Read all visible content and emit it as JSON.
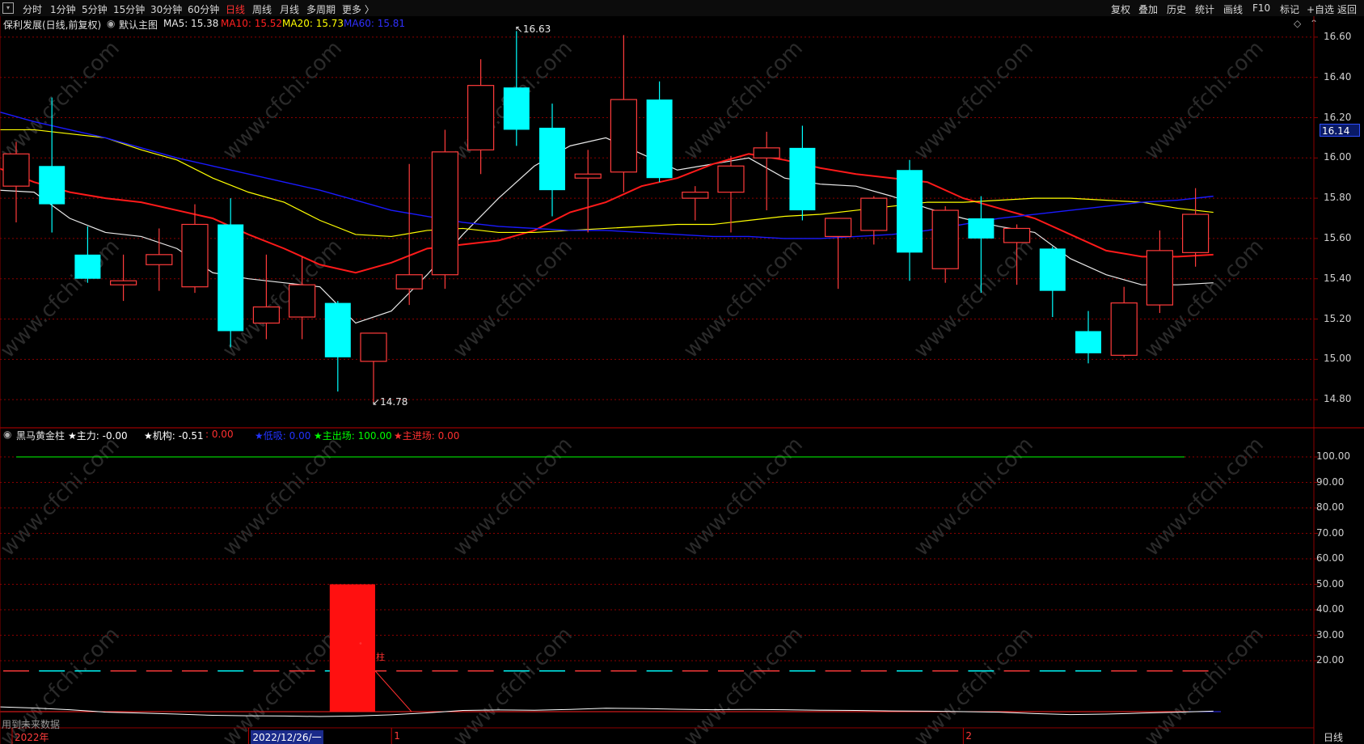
{
  "toolbar": {
    "left": [
      "分时",
      "1分钟",
      "5分钟",
      "15分钟",
      "30分钟",
      "60分钟",
      "日线",
      "周线",
      "月线",
      "多周期",
      "更多 〉"
    ],
    "right": [
      "复权",
      "叠加",
      "历史",
      "统计",
      "画线",
      "F10",
      "标记",
      "+自选",
      "返回"
    ],
    "active": "日线"
  },
  "header": {
    "stock": "保利发展(日线,前复权)",
    "main_chart": "默认主图",
    "ma5": "MA5: 15.38",
    "ma10": "MA10: 15.52",
    "ma20": "MA20: 15.73",
    "ma60": "MA60: 15.81"
  },
  "colors": {
    "up": "#ff3b3b",
    "down": "#00ffff",
    "ma5": "#e8e8e8",
    "ma10": "#ff1a1a",
    "ma20": "#ffff00",
    "ma60": "#1a1aff",
    "grid": "#8b0000",
    "green": "#00ff00"
  },
  "current_price": "16.14",
  "chart_data": [
    {
      "type": "candlestick",
      "title": "保利发展(日线,前复权)",
      "ylim": [
        14.68,
        16.7
      ],
      "ticks": [
        14.8,
        15.0,
        15.2,
        15.4,
        15.6,
        15.8,
        16.0,
        16.2,
        16.4,
        16.6
      ],
      "tick_labels": [
        "14.80",
        "15.00",
        "15.20",
        "15.40",
        "15.60",
        "15.80",
        "16.00",
        "16.20",
        "16.40",
        "16.60"
      ],
      "high_label": "16.63",
      "low_label": "14.78",
      "candles": [
        {
          "o": 15.86,
          "h": 16.08,
          "l": 15.68,
          "c": 16.02
        },
        {
          "o": 15.96,
          "h": 16.3,
          "l": 15.63,
          "c": 15.77
        },
        {
          "o": 15.52,
          "h": 15.66,
          "l": 15.38,
          "c": 15.4
        },
        {
          "o": 15.37,
          "h": 15.52,
          "l": 15.29,
          "c": 15.39
        },
        {
          "o": 15.47,
          "h": 15.65,
          "l": 15.34,
          "c": 15.52
        },
        {
          "o": 15.36,
          "h": 15.77,
          "l": 15.33,
          "c": 15.67
        },
        {
          "o": 15.67,
          "h": 15.8,
          "l": 15.06,
          "c": 15.14
        },
        {
          "o": 15.18,
          "h": 15.52,
          "l": 15.1,
          "c": 15.26
        },
        {
          "o": 15.21,
          "h": 15.51,
          "l": 15.1,
          "c": 15.37
        },
        {
          "o": 15.28,
          "h": 15.29,
          "l": 14.84,
          "c": 15.01
        },
        {
          "o": 14.99,
          "h": 15.13,
          "l": 14.78,
          "c": 15.13
        },
        {
          "o": 15.35,
          "h": 15.97,
          "l": 15.27,
          "c": 15.42
        },
        {
          "o": 15.42,
          "h": 16.14,
          "l": 15.35,
          "c": 16.03
        },
        {
          "o": 16.04,
          "h": 16.49,
          "l": 15.92,
          "c": 16.36
        },
        {
          "o": 16.35,
          "h": 16.63,
          "l": 16.06,
          "c": 16.14
        },
        {
          "o": 16.15,
          "h": 16.27,
          "l": 15.71,
          "c": 15.84
        },
        {
          "o": 15.9,
          "h": 16.04,
          "l": 15.63,
          "c": 15.92
        },
        {
          "o": 15.93,
          "h": 16.61,
          "l": 15.83,
          "c": 16.29
        },
        {
          "o": 16.29,
          "h": 16.38,
          "l": 15.88,
          "c": 15.9
        },
        {
          "o": 15.8,
          "h": 15.86,
          "l": 15.69,
          "c": 15.83
        },
        {
          "o": 15.83,
          "h": 16.01,
          "l": 15.63,
          "c": 15.96
        },
        {
          "o": 16.0,
          "h": 16.13,
          "l": 15.74,
          "c": 16.05
        },
        {
          "o": 16.05,
          "h": 16.16,
          "l": 15.69,
          "c": 15.74
        },
        {
          "o": 15.61,
          "h": 15.69,
          "l": 15.35,
          "c": 15.7
        },
        {
          "o": 15.64,
          "h": 15.81,
          "l": 15.57,
          "c": 15.8
        },
        {
          "o": 15.94,
          "h": 15.99,
          "l": 15.39,
          "c": 15.53
        },
        {
          "o": 15.45,
          "h": 15.76,
          "l": 15.38,
          "c": 15.74
        },
        {
          "o": 15.7,
          "h": 15.81,
          "l": 15.33,
          "c": 15.6
        },
        {
          "o": 15.58,
          "h": 15.67,
          "l": 15.37,
          "c": 15.65
        },
        {
          "o": 15.55,
          "h": 15.56,
          "l": 15.21,
          "c": 15.34
        },
        {
          "o": 15.14,
          "h": 15.24,
          "l": 14.98,
          "c": 15.03
        },
        {
          "o": 15.02,
          "h": 15.36,
          "l": 15.01,
          "c": 15.28
        },
        {
          "o": 15.27,
          "h": 15.64,
          "l": 15.23,
          "c": 15.54
        },
        {
          "o": 15.53,
          "h": 15.85,
          "l": 15.46,
          "c": 15.72
        }
      ],
      "series": [
        {
          "name": "MA5",
          "values": [
            15.84,
            15.83,
            15.7,
            15.63,
            15.61,
            15.55,
            15.43,
            15.4,
            15.38,
            15.36,
            15.18,
            15.24,
            15.42,
            15.62,
            15.8,
            15.96,
            16.06,
            16.1,
            16.02,
            15.94,
            15.97,
            16.0,
            15.9,
            15.87,
            15.86,
            15.81,
            15.75,
            15.7,
            15.66,
            15.63,
            15.5,
            15.42,
            15.37,
            15.37,
            15.38
          ]
        },
        {
          "name": "MA10",
          "values": [
            15.95,
            15.88,
            15.83,
            15.8,
            15.78,
            15.74,
            15.7,
            15.62,
            15.55,
            15.47,
            15.43,
            15.48,
            15.55,
            15.57,
            15.59,
            15.64,
            15.73,
            15.78,
            15.86,
            15.9,
            15.97,
            16.02,
            15.99,
            15.95,
            15.92,
            15.9,
            15.88,
            15.8,
            15.75,
            15.7,
            15.62,
            15.54,
            15.51,
            15.51,
            15.52
          ]
        },
        {
          "name": "MA20",
          "values": [
            16.14,
            16.14,
            16.12,
            16.1,
            16.04,
            15.99,
            15.9,
            15.83,
            15.78,
            15.69,
            15.62,
            15.61,
            15.64,
            15.65,
            15.63,
            15.63,
            15.64,
            15.65,
            15.66,
            15.67,
            15.67,
            15.69,
            15.71,
            15.72,
            15.74,
            15.76,
            15.78,
            15.78,
            15.79,
            15.8,
            15.8,
            15.79,
            15.78,
            15.75,
            15.73
          ]
        },
        {
          "name": "MA60",
          "values": [
            16.23,
            16.18,
            16.14,
            16.1,
            16.05,
            16.0,
            15.96,
            15.92,
            15.88,
            15.84,
            15.79,
            15.74,
            15.71,
            15.68,
            15.66,
            15.65,
            15.64,
            15.64,
            15.63,
            15.62,
            15.61,
            15.61,
            15.6,
            15.6,
            15.61,
            15.62,
            15.64,
            15.67,
            15.7,
            15.72,
            15.74,
            15.76,
            15.78,
            15.79,
            15.81
          ]
        }
      ]
    },
    {
      "type": "bar",
      "title": "黑马黄金柱",
      "ylim": [
        0,
        107
      ],
      "ticks": [
        20,
        30,
        40,
        50,
        60,
        70,
        80,
        90,
        100
      ],
      "tick_labels": [
        "20.00",
        "30.00",
        "40.00",
        "50.00",
        "60.00",
        "70.00",
        "80.00",
        "90.00",
        "100.00"
      ],
      "bar": {
        "from_index": 9,
        "to_index": 10,
        "value": 50
      },
      "guide_line": 100,
      "dashed_line": 16,
      "bar_label": "柱",
      "legend": [
        {
          "text": "★主力: -0.00",
          "color": "#ffffff"
        },
        {
          "text": "★机构: -0.51",
          "color": "#ffffff"
        },
        {
          "text": ": 0.00",
          "color": "#ff3030"
        },
        {
          "text": "★低吸: 0.00",
          "color": "#2233ff"
        },
        {
          "text": "★主出场: 100.00",
          "color": "#00ff00"
        },
        {
          "text": "★主进场: 0.00",
          "color": "#ff3030"
        }
      ]
    }
  ],
  "footer_note": "用到未来数据",
  "x_labels": [
    {
      "text": "2022年",
      "index": 0,
      "color": "#ff3b3b"
    },
    {
      "text": "2022/12/26/一",
      "index": 7,
      "color": "#ffffff",
      "highlight": true
    },
    {
      "text": "1",
      "index": 11,
      "color": "#ff3b3b"
    },
    {
      "text": "2",
      "index": 27,
      "color": "#ff3b3b"
    }
  ],
  "bottom_tab": "日线",
  "watermark": "www.cfchi.com"
}
